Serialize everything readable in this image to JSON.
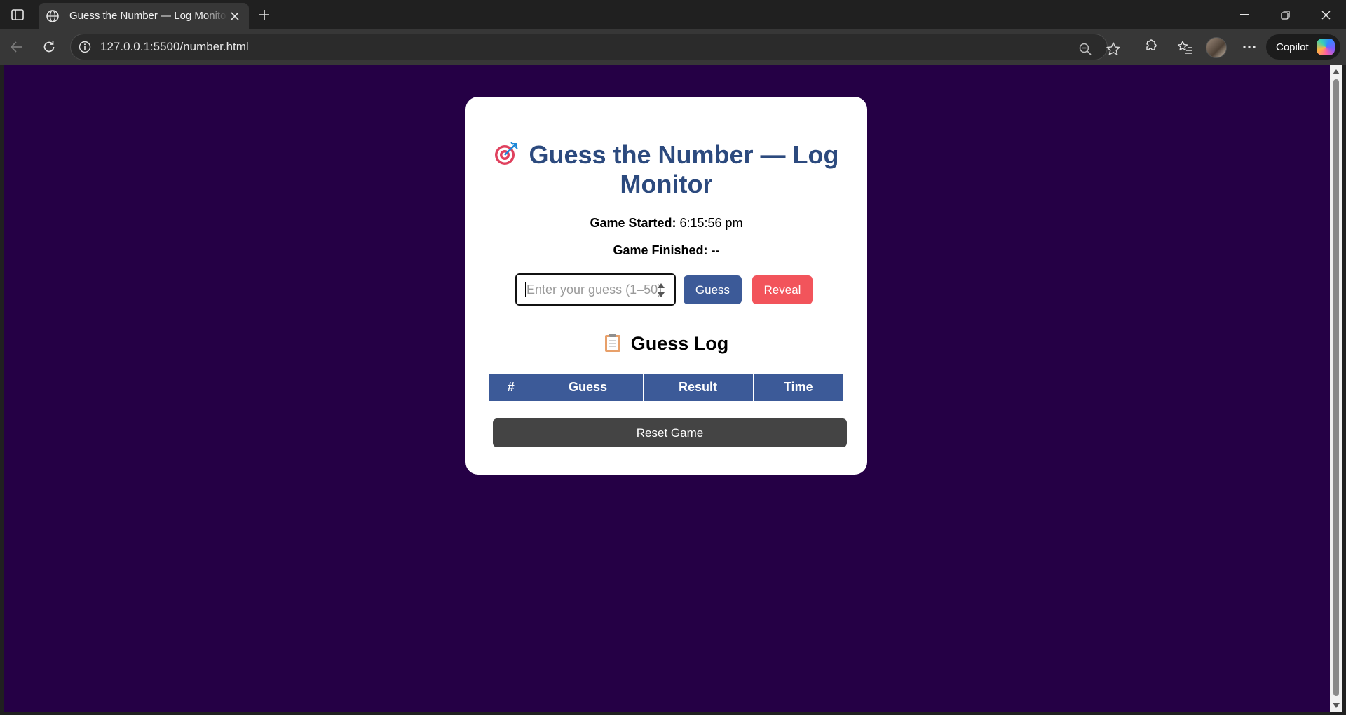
{
  "browser": {
    "tab_title": "Guess the Number — Log Monitor",
    "url": "127.0.0.1:5500/number.html",
    "copilot_label": "Copilot"
  },
  "game": {
    "title": "Guess the Number — Log Monitor",
    "started_label": "Game Started:",
    "started_value": "6:15:56 pm",
    "finished_label": "Game Finished:",
    "finished_value": "--",
    "input_placeholder": "Enter your guess (1–50)",
    "guess_button": "Guess",
    "reveal_button": "Reveal",
    "log_heading": "Guess Log",
    "log_columns": [
      "#",
      "Guess",
      "Result",
      "Time"
    ],
    "reset_button": "Reset Game"
  },
  "colors": {
    "page_background": "#250045",
    "title": "#2c4a7e",
    "primary_button": "#3c5a98",
    "reveal_button": "#f2545b",
    "reset_button": "#444444"
  },
  "icons": [
    "target-icon",
    "clipboard-icon",
    "globe-icon",
    "refresh-icon",
    "star-icon",
    "zoom-out-icon"
  ]
}
